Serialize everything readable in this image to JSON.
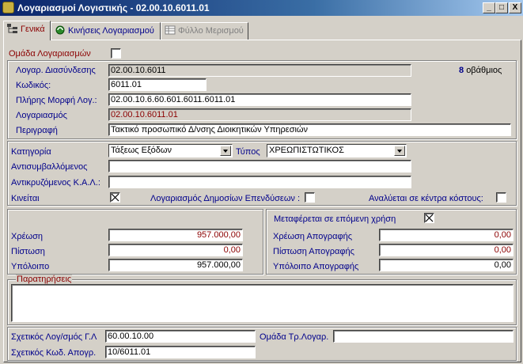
{
  "window": {
    "title": "Λογαριασμοί Λογιστικής - 02.00.10.6011.01",
    "minimize": "_",
    "maximize": "□",
    "close": "X"
  },
  "tabs": [
    {
      "label": "Γενικά",
      "icon": "tree-icon"
    },
    {
      "label": "Κινήσεις Λογαριασμού",
      "icon": "refresh-icon"
    },
    {
      "label": "Φύλλο Μερισμού",
      "icon": "sheet-icon"
    }
  ],
  "general": {
    "group_label": "Ομάδα Λογαριασμών",
    "link_account_label": "Λογαρ. Διασύνδεσης",
    "link_account_value": "02.00.10.6011",
    "level_value": "8",
    "level_label": "οβάθμιος",
    "code_label": "Κωδικός:",
    "code_value": "6011.01",
    "fullform_label": "Πλήρης Μορφή Λογ.:",
    "fullform_value": "02.00.10.6.60.601.6011.6011.01",
    "account_label": "Λογαριασμός",
    "account_value": "02.00.10.6011.01",
    "description_label": "Περιγραφή",
    "description_value": "Τακτικό προσωπικό Δ/νσης Διοικητικών Υπηρεσιών"
  },
  "category": {
    "category_label": "Κατηγορία",
    "category_value": "Τάξεως Εξόδων",
    "type_label": "Τύπος",
    "type_value": "ΧΡΕΩΠΙΣΤΩΤΙΚΟΣ",
    "counter_label": "Αντισυμβαλλόμενος",
    "counter_value": "",
    "counterkal_label": "Αντικρυζόμενος Κ.Α.Λ.:",
    "counterkal_value": "",
    "moves_label": "Κινείται",
    "moves_checked": true,
    "public_inv_label": "Λογαριασμός Δημοσίων Επενδύσεων :",
    "public_inv_checked": false,
    "costcenter_label": "Αναλύεται σε κέντρα κόστους:",
    "costcenter_checked": false
  },
  "balances": {
    "debit_label": "Χρέωση",
    "debit_value": "957.000,00",
    "credit_label": "Πίστωση",
    "credit_value": "0,00",
    "balance_label": "Υπόλοιπο",
    "balance_value": "957.000,00",
    "carry_label": "Μεταφέρεται σε επόμενη χρήση",
    "carry_checked": true,
    "inv_debit_label": "Χρέωση Απογραφής",
    "inv_debit_value": "0,00",
    "inv_credit_label": "Πίστωση Απογραφής",
    "inv_credit_value": "0,00",
    "inv_balance_label": "Υπόλοιπο Απογραφής",
    "inv_balance_value": "0,00"
  },
  "notes": {
    "label": "Παρατηρήσεις",
    "value": ""
  },
  "related": {
    "gl_label": "Σχετικός Λογ/σμός Γ.Λ",
    "gl_value": "60.00.10.00",
    "trgroup_label": "Ομάδα Τρ.Λογαρ.",
    "trgroup_value": "",
    "invcode_label": "Σχετικός Κωδ. Απογρ.",
    "invcode_value": "10/6011.01"
  }
}
